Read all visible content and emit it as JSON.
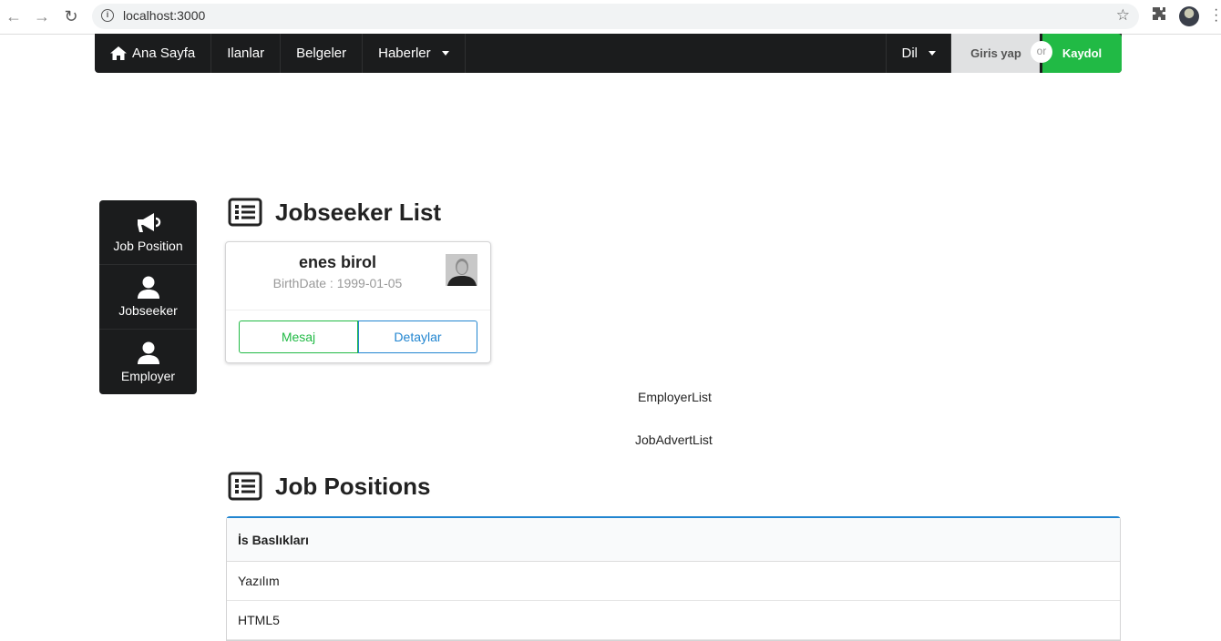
{
  "browser": {
    "url": "localhost:3000"
  },
  "topnav": {
    "items": [
      {
        "label": "Ana Sayfa",
        "icon": "home-icon"
      },
      {
        "label": "Ilanlar"
      },
      {
        "label": "Belgeler"
      },
      {
        "label": "Haberler"
      }
    ],
    "lang_label": "Dil",
    "login_label": "Giris yap",
    "or_label": "or",
    "signup_label": "Kaydol"
  },
  "sidemenu": {
    "items": [
      {
        "label": "Job Position",
        "icon": "megaphone-icon"
      },
      {
        "label": "Jobseeker",
        "icon": "user-icon"
      },
      {
        "label": "Employer",
        "icon": "user-icon"
      }
    ]
  },
  "jobseeker_section": {
    "title": "Jobseeker List",
    "card": {
      "name": "enes birol",
      "meta": "BirthDate : 1999-01-05",
      "message_label": "Mesaj",
      "details_label": "Detaylar"
    }
  },
  "employer_list_label": "EmployerList",
  "job_advert_list_label": "JobAdvertList",
  "positions_section": {
    "title": "Job Positions",
    "column_header": "İs Baslıkları",
    "rows": [
      "Yazılım",
      "HTML5"
    ]
  },
  "colors": {
    "navbar": "#1b1c1d",
    "success": "#21ba45",
    "primary": "#2185d0"
  }
}
